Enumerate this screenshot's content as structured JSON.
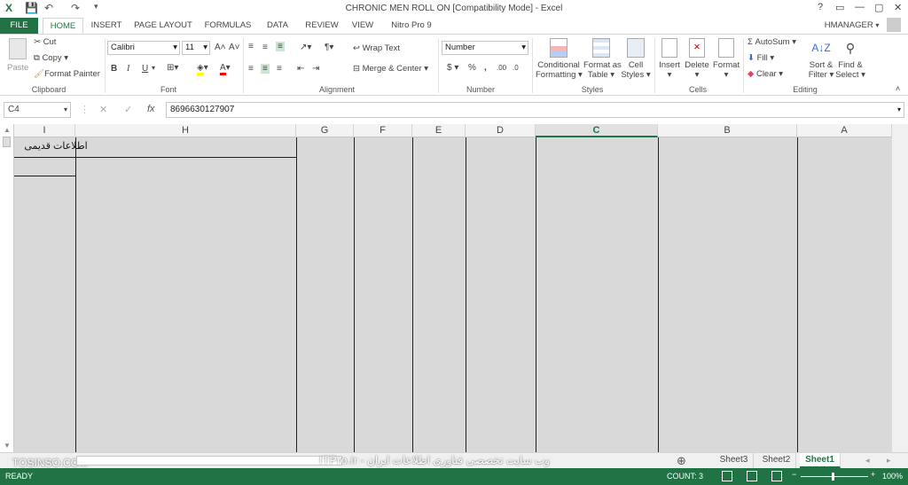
{
  "window": {
    "title": "CHRONIC MEN ROLL ON  [Compatibility Mode] - Excel",
    "controls": [
      "?",
      "▭",
      "—",
      "▢",
      "✕"
    ]
  },
  "tabs": [
    "FILE",
    "HOME",
    "INSERT",
    "PAGE LAYOUT",
    "FORMULAS",
    "DATA",
    "REVIEW",
    "VIEW",
    "Nitro Pro 9"
  ],
  "user": "HMANAGER",
  "ribbon": {
    "clipboard": {
      "label": "Clipboard",
      "paste": "Paste",
      "cut": "Cut",
      "copy": "Copy",
      "format_painter": "Format Painter"
    },
    "font": {
      "label": "Font",
      "name": "Calibri",
      "size": "11",
      "bold": "B",
      "italic": "I",
      "underline": "U"
    },
    "alignment": {
      "label": "Alignment",
      "wrap": "Wrap Text",
      "merge": "Merge & Center"
    },
    "number": {
      "label": "Number",
      "format": "Number",
      "currency": "$",
      "percent": "%",
      "comma": ","
    },
    "styles": {
      "label": "Styles",
      "conditional": "Conditional",
      "conditional2": "Formatting",
      "format_table": "Format as",
      "format_table2": "Table",
      "cell_styles": "Cell",
      "cell_styles2": "Styles"
    },
    "cells": {
      "label": "Cells",
      "insert": "Insert",
      "delete": "Delete",
      "format": "Format"
    },
    "editing": {
      "label": "Editing",
      "autosum": "AutoSum",
      "fill": "Fill",
      "clear": "Clear",
      "sort": "Sort &",
      "sort2": "Filter",
      "find": "Find &",
      "find2": "Select"
    }
  },
  "formula": {
    "namebox": "C4",
    "value": "8696630127907",
    "fx": "fx"
  },
  "columns": [
    "I",
    "H",
    "G",
    "F",
    "E",
    "D",
    "C",
    "B",
    "A"
  ],
  "cell_text": "اطلاعات قدیمی",
  "sheets": [
    "Sheet3",
    "Sheet2",
    "Sheet1"
  ],
  "watermark": "وب سایت تخصصی فناوری اطلاعات ایران - ITPro.ir",
  "watermark_left": "TOSINSO.COM",
  "status": {
    "ready": "READY",
    "count": "COUNT: 3",
    "zoom": "100%"
  }
}
